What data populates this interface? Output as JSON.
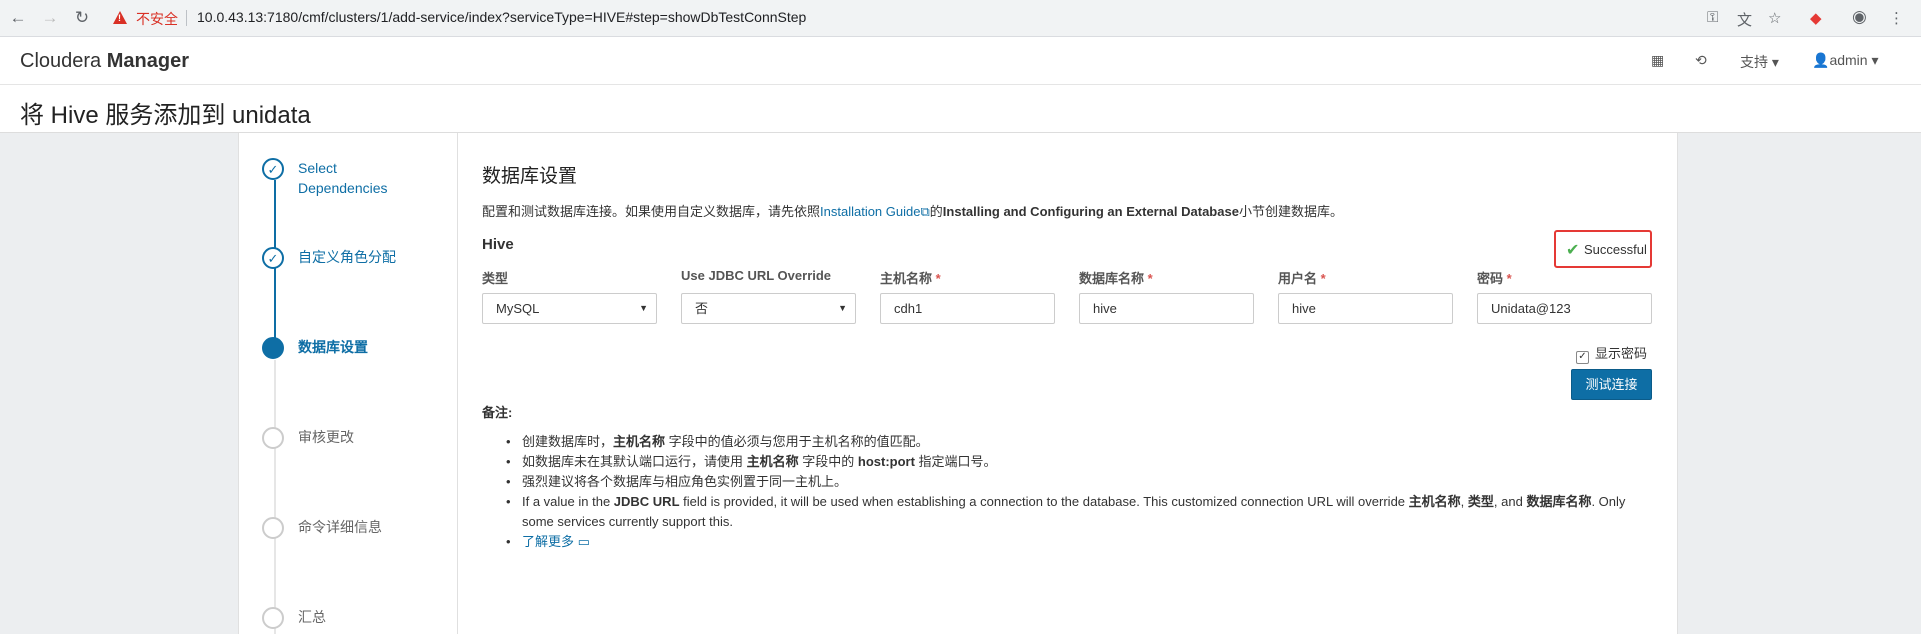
{
  "browser": {
    "insecure_label": "不安全",
    "url": "10.0.43.13:7180/cmf/clusters/1/add-service/index?serviceType=HIVE#step=showDbTestConnStep"
  },
  "header": {
    "brand_prefix": "Cloudera",
    "brand_suffix": "Manager",
    "support_label": "支持",
    "user_label": "admin"
  },
  "page_title": "将 Hive 服务添加到 unidata",
  "steps": [
    {
      "label_line1": "Select",
      "label_line2": "Dependencies",
      "state": "done"
    },
    {
      "label": "自定义角色分配",
      "state": "done"
    },
    {
      "label": "数据库设置",
      "state": "active"
    },
    {
      "label": "审核更改",
      "state": "todo"
    },
    {
      "label": "命令详细信息",
      "state": "todo"
    },
    {
      "label": "汇总",
      "state": "todo"
    }
  ],
  "section": {
    "title": "数据库设置",
    "intro_pre": "配置和测试数据库连接。如果使用自定义数据库，请先依照",
    "intro_link": "Installation Guide",
    "intro_mid": "的",
    "intro_bold": "Installing and Configuring an External Database",
    "intro_post": "小节创建数据库。"
  },
  "hive": {
    "label": "Hive",
    "status": "Successful",
    "fields": {
      "type_label": "类型",
      "type_value": "MySQL",
      "jdbc_label": "Use JDBC URL Override",
      "jdbc_value": "否",
      "host_label": "主机名称",
      "host_value": "cdh1",
      "dbname_label": "数据库名称",
      "dbname_value": "hive",
      "user_label": "用户名",
      "user_value": "hive",
      "pw_label": "密码",
      "pw_value": "Unidata@123"
    },
    "show_password_label": "显示密码",
    "test_button": "测试连接"
  },
  "notes": {
    "title": "备注",
    "n1_a": "创建数据库时，",
    "n1_b": "主机名称",
    "n1_c": " 字段中的值必须与您用于主机名称的值匹配。",
    "n2_a": "如数据库未在其默认端口运行，请使用 ",
    "n2_b": "主机名称",
    "n2_c": " 字段中的 ",
    "n2_d": "host:port",
    "n2_e": " 指定端口号。",
    "n3": "强烈建议将各个数据库与相应角色实例置于同一主机上。",
    "n4_a": "If a value in the ",
    "n4_b": "JDBC URL",
    "n4_c": " field is provided, it will be used when establishing a connection to the database. This customized connection URL will override ",
    "n4_d": "主机名称",
    "n4_e": ", ",
    "n4_f": "类型",
    "n4_g": ", and ",
    "n4_h": "数据库名称",
    "n4_i": ". Only some services currently support this.",
    "learn_more": "了解更多"
  }
}
